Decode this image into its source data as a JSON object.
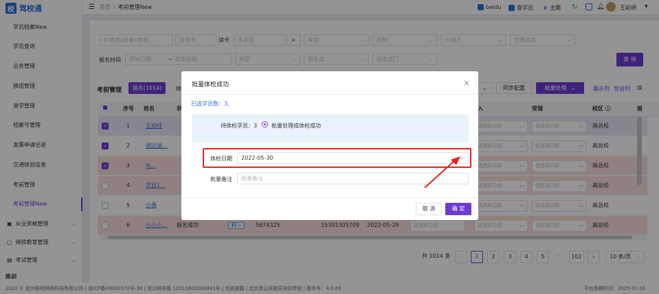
{
  "app": {
    "logo_char": "校",
    "logo_text": "驾校通"
  },
  "sidebar": {
    "items": [
      {
        "label": "学员档案New"
      },
      {
        "label": "学员查询"
      },
      {
        "label": "业务管理"
      },
      {
        "label": "换班管理"
      },
      {
        "label": "退学管理"
      },
      {
        "label": "档案号管理"
      },
      {
        "label": "发票申请记录"
      },
      {
        "label": "交通体验信息"
      },
      {
        "label": "考前管理"
      },
      {
        "label": "考前管理New"
      }
    ],
    "groups": [
      {
        "label": "从业资格管理"
      },
      {
        "label": "继续教育管理"
      },
      {
        "label": "考试管理"
      }
    ],
    "bottom_label": "练训"
  },
  "topbar": {
    "breadcrumb_home": "首页",
    "breadcrumb_sep": "/",
    "breadcrumb_current": "考前管理New",
    "baidu": "baidu",
    "search_student": "查学员",
    "theme": "主题",
    "user": "王彩妍"
  },
  "filters": {
    "name_placeholder": "姓名(拼音)/手机...",
    "cert_placeholder": "证件号",
    "read_card": "读卡",
    "more_students": "多学员",
    "car_type": "车型",
    "class_type": "班制",
    "introducer": "介绍人",
    "debt_status": "欠费状态",
    "signup_time_label": "报名时间",
    "start_date": "开始日期",
    "end_date": "结束日期",
    "campus": "校区",
    "signup_point": "报名点",
    "recruit_dept": "招生部门",
    "search_button": "查 询"
  },
  "toolbar": {
    "title": "考前管理",
    "tab_active": "报名(1014)",
    "tab_next": "体",
    "sync_config": "同步配置",
    "batch_process": "批量处理",
    "display_columns": "展示列",
    "export_columns": "导出列"
  },
  "table": {
    "headers": {
      "seq": "序号",
      "name": "姓名",
      "status_col": "状",
      "accept": "受理",
      "col_in": "入",
      "campus": "校区",
      "report": "报"
    },
    "rows": [
      {
        "seq": "1",
        "name": "王如旺",
        "campus": "高总校",
        "checked": true,
        "tint": "purple"
      },
      {
        "seq": "2",
        "name": "测试录...",
        "campus": "高总校",
        "checked": true,
        "tint": "none"
      },
      {
        "seq": "3",
        "name": "lll...",
        "campus": "高总校",
        "checked": true,
        "tint": "red"
      },
      {
        "seq": "4",
        "name": "学员1...",
        "campus": "高总校",
        "checked": false,
        "tint": "red"
      },
      {
        "seq": "5",
        "name": "小责",
        "campus": "高总校",
        "checked": false,
        "tint": "none"
      },
      {
        "seq": "6",
        "name": "小小小...",
        "campus": "高总校",
        "checked": false,
        "tint": "red",
        "status": "报名成功",
        "tag": "科一",
        "num": "5674325",
        "phone": "15301305709",
        "date": "2022-05-29"
      }
    ],
    "date_placeholder": "请选择日期"
  },
  "pagination": {
    "total": "共 1014 条",
    "pages": [
      "1",
      "2",
      "3",
      "4",
      "5"
    ],
    "ellipsis": "···",
    "last": "102",
    "page_size": "10 条/页"
  },
  "modal": {
    "title": "批量体检成功",
    "selected_count": "已选学员数：3,",
    "pending_label": "待体检学员：3",
    "radio_label": "批量处理成体检成功",
    "exam_date_label": "体检日期",
    "exam_date_value": "2022-05-30",
    "remark_label": "批量备注",
    "remark_placeholder": "批量备注",
    "cancel": "取 消",
    "confirm": "确 定"
  },
  "footer": {
    "text": "2022 © 杭州联校网络科技有限公司 | 浙ICP备09002072号-38 | 浙公网安备 12011602000841号 | 信息披露 | 北京青山驾驶员培训学校 | 版本号：4.0.69",
    "right": "平台到期时间：2025-01-01"
  },
  "colors": {
    "accent": "#6d3bd4",
    "brand": "#2a6fd6",
    "highlight": "#e02424"
  }
}
